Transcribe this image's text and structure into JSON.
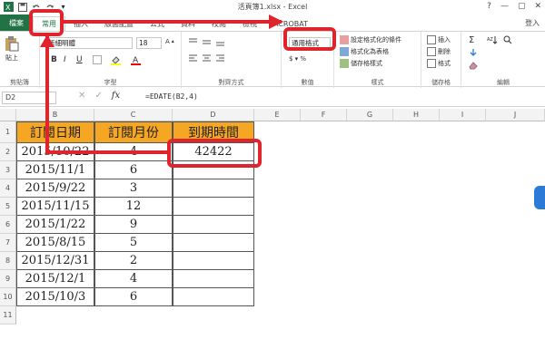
{
  "titlebar": {
    "title": "活頁簿1.xlsx - Excel",
    "help": "?",
    "minimize": "—",
    "restore": "▢",
    "close": "✕"
  },
  "tabs": [
    {
      "label": "檔案"
    },
    {
      "label": "常用"
    },
    {
      "label": "插入"
    },
    {
      "label": "版面配置"
    },
    {
      "label": "公式"
    },
    {
      "label": "資料"
    },
    {
      "label": "校閱"
    },
    {
      "label": "檢視"
    },
    {
      "label": "ACROBAT"
    }
  ],
  "signin": "登入",
  "ribbon": {
    "clipboard": {
      "paste": "貼上",
      "label": "剪貼簿"
    },
    "font": {
      "name": "新細明體",
      "size": "18",
      "bold": "B",
      "italic": "I",
      "underline": "U",
      "label": "字型"
    },
    "alignment": {
      "label": "對齊方式"
    },
    "number": {
      "format": "通用格式",
      "label": "數值"
    },
    "styles": {
      "conditional": "設定格式化的條件",
      "table": "格式化為表格",
      "cell_styles": "儲存格樣式",
      "label": "樣式"
    },
    "cells": {
      "insert": "插入",
      "delete": "刪除",
      "format": "格式",
      "label": "儲存格"
    },
    "editing": {
      "sigma": "Σ",
      "label": "編輯"
    }
  },
  "formulabar": {
    "namebox": "D2",
    "cancel": "✕",
    "enter": "✓",
    "fx": "fx",
    "formula": "=EDATE(B2,4)"
  },
  "grid": {
    "columns": [
      "B",
      "C",
      "D",
      "E",
      "F",
      "G",
      "H",
      "I",
      "J"
    ],
    "rows": [
      "1",
      "2",
      "3",
      "4",
      "5",
      "6",
      "7",
      "8",
      "9",
      "10",
      "11"
    ],
    "headers": {
      "b": "訂閱日期",
      "c": "訂閱月份",
      "d": "到期時間"
    },
    "data": [
      {
        "date": "2015/10/22",
        "months": "4",
        "due": "42422"
      },
      {
        "date": "2015/11/1",
        "months": "6",
        "due": ""
      },
      {
        "date": "2015/9/22",
        "months": "3",
        "due": ""
      },
      {
        "date": "2015/11/15",
        "months": "12",
        "due": ""
      },
      {
        "date": "2015/1/22",
        "months": "9",
        "due": ""
      },
      {
        "date": "2015/8/15",
        "months": "5",
        "due": ""
      },
      {
        "date": "2015/12/31",
        "months": "2",
        "due": ""
      },
      {
        "date": "2015/12/1",
        "months": "4",
        "due": ""
      },
      {
        "date": "2015/10/3",
        "months": "6",
        "due": ""
      }
    ]
  },
  "colors": {
    "excel_green": "#217346",
    "header_fill": "#f5a623",
    "highlight": "#e0242d"
  }
}
